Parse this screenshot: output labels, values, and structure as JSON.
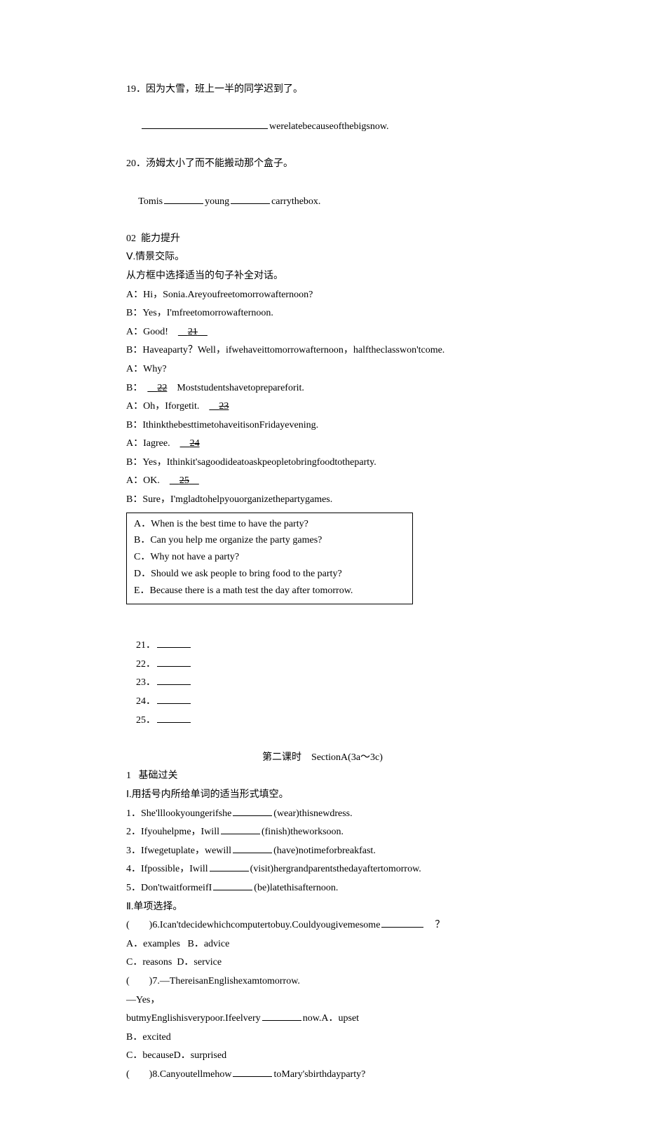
{
  "q19": "19．因为大雪，班上一半的同学迟到了。",
  "q19_tail": "werelatebecauseofthebigsnow.",
  "q20": "20．汤姆太小了而不能搬动那个盒子。",
  "q20_line_a": " Tomis",
  "q20_line_b": "young",
  "q20_line_c": "carrythebox.",
  "sec02": "02  能力提升",
  "sec5": "Ⅴ.情景交际。",
  "sec5_sub": "从方框中选择适当的句子补全对话。",
  "dA1": "A：Hi，Sonia.Areyoufreetomorrowafternoon?",
  "dB1": "B：Yes，I'mfreetomorrowafternoon.",
  "dA2_pre": "A：Good!　",
  "dA2_num": "21",
  "dB2": "B：Haveaparty？Well，ifwehaveittomorrowafternoon，halftheclasswon'tcome.",
  "dA3": "A：Why?",
  "dB3_pre": "B：　",
  "dB3_num": "22",
  "dB3_post": "　Moststudentshavetoprepareforit.",
  "dA4_pre": "A：Oh，Iforgetit.　",
  "dA4_num": "23",
  "dA4_post": "　",
  "dB4": "B：IthinkthebesttimetohaveitisonFridayevening.",
  "dA5_pre": "A：Iagree.　",
  "dA5_num": "24",
  "dA5_post": "　",
  "dB5": "B：Yes，Ithinkit'sagoodideatoaskpeopletobringfoodtotheparty.",
  "dA6_pre": "A：OK.　",
  "dA6_num": "25",
  "dB6": "B：Sure，I'mgladtohelpyouorganizethepartygames.",
  "optA": "A．When is the best time to have the party?",
  "optB": "B．Can you help me organize the party games?",
  "optC": "C．Why not have a party?",
  "optD": "D．Should we ask people to bring food to the party?",
  "optE": "E．Because there is a math test the day after tomorrow.",
  "ans21": "21．",
  "ans22": "22．",
  "ans23": "23．",
  "ans24": "24．",
  "ans25": "25．",
  "lesson_title": "第二课时　SectionA(3a～3c)",
  "sec1": "1   基础过关",
  "secI": "Ⅰ.用括号内所给单词的适当形式填空。",
  "p1_a": "1．She'lllookyoungerifshe",
  "p1_b": "(wear)thisnewdress.",
  "p2_a": "2．Ifyouhelpme，Iwill",
  "p2_b": "(finish)theworksoon.",
  "p3_a": "3．Ifwegetuplate，wewill",
  "p3_b": "(have)notimeforbreakfast.",
  "p4_a": "4．Ifpossible，Iwill",
  "p4_b": "(visit)hergrandparentsthedayaftertomorrow.",
  "p5_a": "5．Don'twaitformeifI",
  "p5_b": "(be)latethisafternoon.",
  "secII": "Ⅱ.单项选择。",
  "m6_a": "(　　)6.Ican'tdecidewhichcomputertobuy.Couldyougivemesome",
  "m6_b": "？",
  "m6_opts1": "A．examples   B．advice",
  "m6_opts2": "C．reasons  D．service",
  "m7_a": "(　　)7.—ThereisanEnglishexamtomorrow.",
  "m7_b": "—Yes，",
  "m7_c_a": "butmyEnglishisverypoor.Ifeelvery",
  "m7_c_b": "now.A．upset",
  "m7_opts1": "B．excited",
  "m7_opts2": "C．becauseD．surprised",
  "m8_a": "(　　)8.Canyoutellmehow",
  "m8_b": "toMary'sbirthdayparty?"
}
